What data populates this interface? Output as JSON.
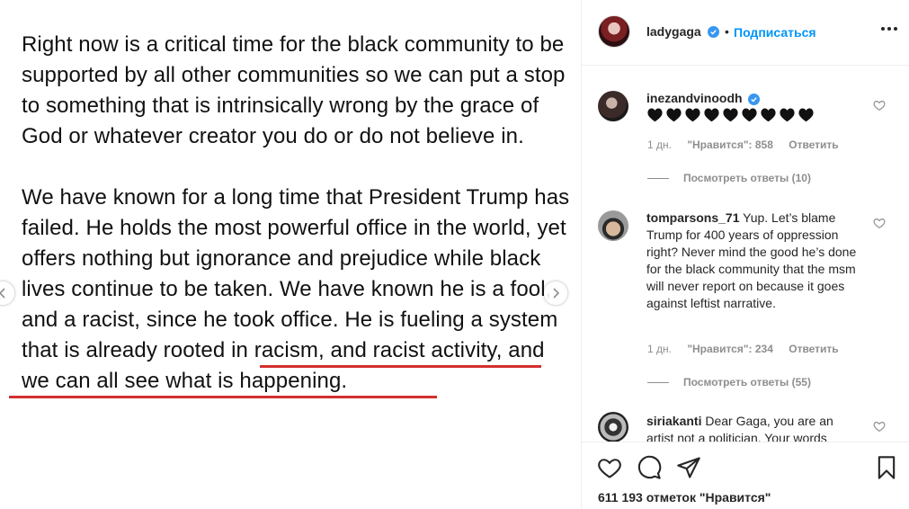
{
  "post": {
    "paragraph1": "Right now is a critical time for the black community to be supported by all other communities so we can put a stop to something that is intrinsically wrong by the grace of God or whatever creator you do or do not believe in.",
    "paragraph2_before": "We have known for a long time that President Trump has failed. He holds the most powerful office in the world, yet offers nothing but ignorance and prejudice while black lives continue to be taken. ",
    "paragraph2_underlined": "We have known he is a fool, and a racist, since he took office.",
    "paragraph2_after": " He is fueling a system that is already rooted in racism, and racist activity, and we can all see what is happening."
  },
  "header": {
    "username": "ladygaga",
    "dot": "•",
    "follow_label": "Подписаться"
  },
  "comments": [
    {
      "username": "inezandvinoodh",
      "text": "",
      "hearts": 9,
      "time": "1 дн.",
      "likes": "\"Нравится\": 858",
      "reply": "Ответить",
      "view_replies": "Посмотреть ответы (10)"
    },
    {
      "username": "tomparsons_71",
      "text": "Yup. Let’s blame Trump for 400 years of oppression right? Never mind the good he’s done for the black community that the msm will never report on because it goes against leftist narrative.",
      "time": "1 дн.",
      "likes": "\"Нравится\": 234",
      "reply": "Ответить",
      "view_replies": "Посмотреть ответы (55)"
    },
    {
      "username": "siriakanti",
      "text": "Dear Gaga, you are an artist not a politician. Your words"
    }
  ],
  "footer": {
    "likes_count": "611 193 отметок \"Нравится\""
  },
  "colors": {
    "accent": "#0095f6",
    "verified": "#3897f0",
    "underline": "#d32f2f",
    "muted": "#8e8e8e"
  }
}
